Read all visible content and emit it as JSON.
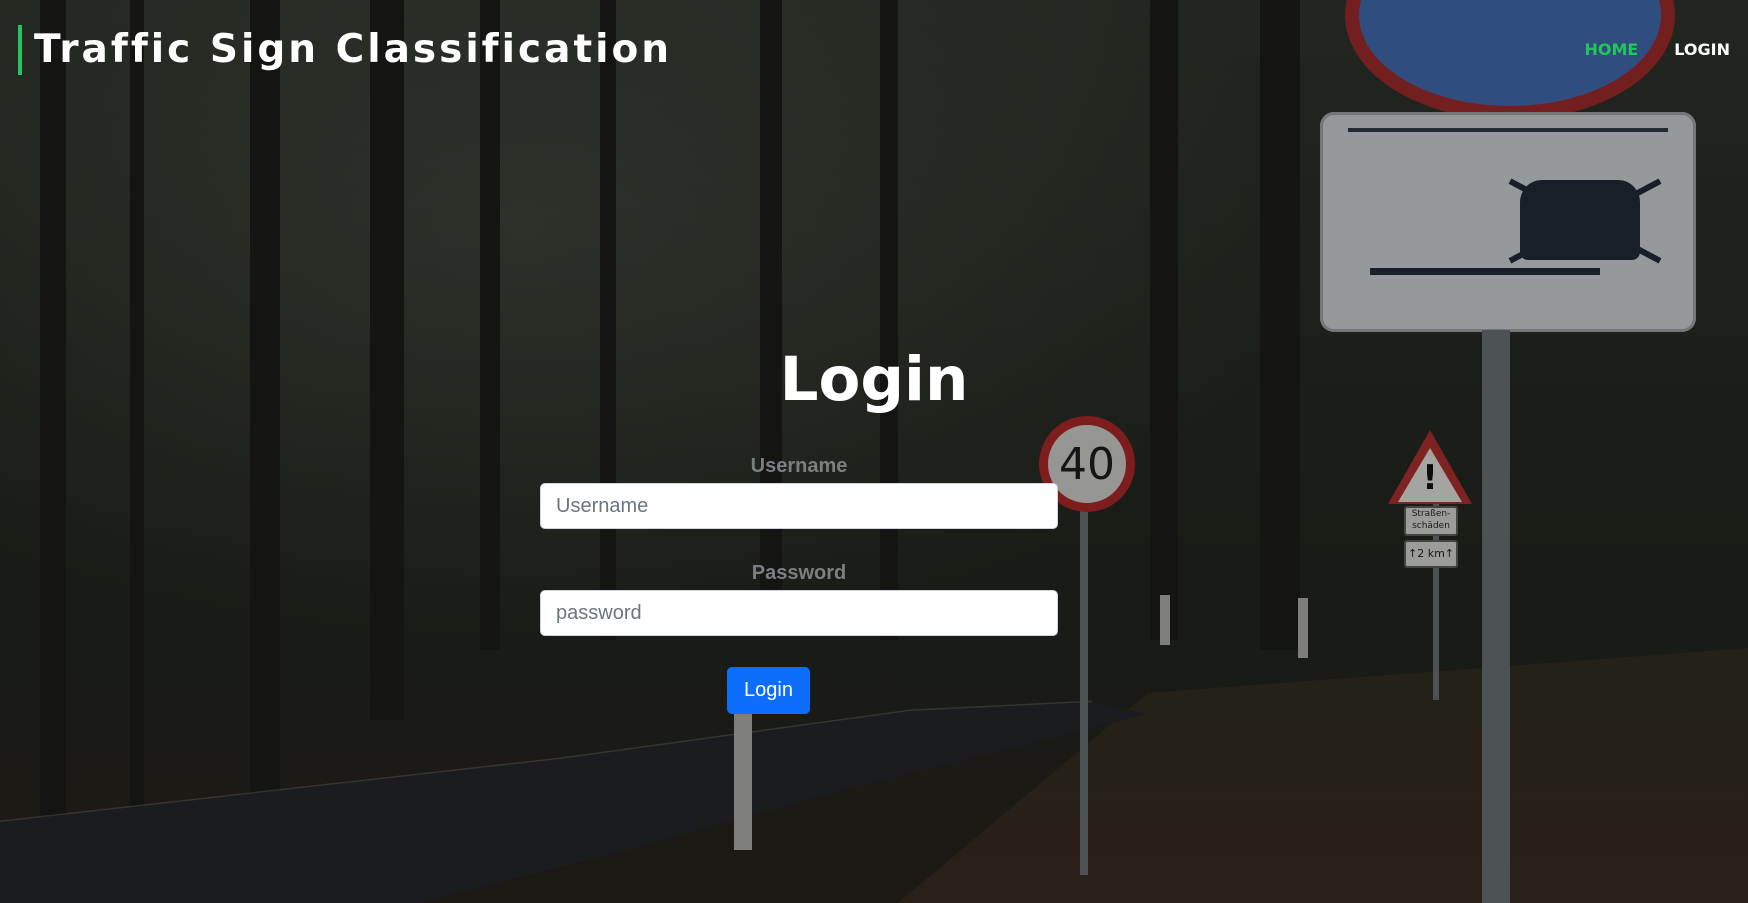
{
  "header": {
    "brand": "Traffic Sign Classification",
    "nav": [
      {
        "label": "HOME",
        "active": true
      },
      {
        "label": "LOGIN",
        "active": false
      }
    ]
  },
  "background": {
    "speed_sign_text": "40",
    "warning_sign_mark": "!",
    "plate_line1": "Straßen-\nschäden",
    "plate_line2": "↑2 km↑"
  },
  "login_form": {
    "title": "Login",
    "username_label": "Username",
    "username_placeholder": "Username",
    "password_label": "Password",
    "password_placeholder": "password",
    "submit_label": "Login"
  },
  "colors": {
    "accent_green": "#22c55e",
    "button_blue": "#0d6efd"
  }
}
